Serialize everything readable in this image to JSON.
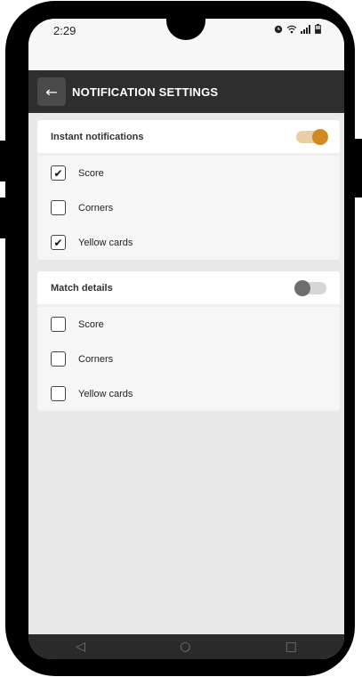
{
  "status": {
    "time": "2:29",
    "icons": [
      "alarm-icon",
      "wifi-icon",
      "signal-icon",
      "battery-icon"
    ]
  },
  "appbar": {
    "title": "NOTIFICATION SETTINGS",
    "back_icon": "←"
  },
  "sections": [
    {
      "title": "Instant notifications",
      "toggle_on": true,
      "options": [
        {
          "label": "Score",
          "checked": true
        },
        {
          "label": "Corners",
          "checked": false
        },
        {
          "label": "Yellow cards",
          "checked": true
        }
      ]
    },
    {
      "title": "Match details",
      "toggle_on": false,
      "options": [
        {
          "label": "Score",
          "checked": false
        },
        {
          "label": "Corners",
          "checked": false
        },
        {
          "label": "Yellow cards",
          "checked": false
        }
      ]
    }
  ],
  "navbar": {
    "back": "◁",
    "home": "○",
    "recent": "□"
  },
  "colors": {
    "accent": "#d18a1f",
    "appbar": "#2e2e2e",
    "background": "#e8e8e8"
  }
}
